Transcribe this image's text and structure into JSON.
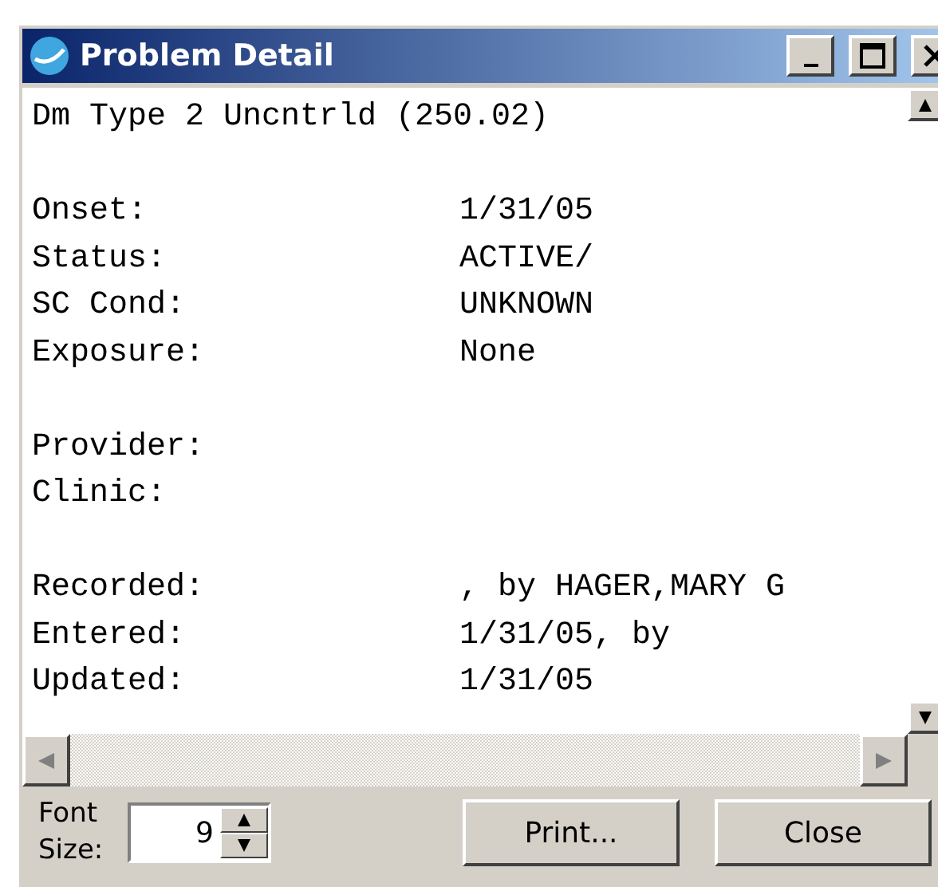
{
  "window": {
    "title": "Problem Detail"
  },
  "problem": "Dm Type 2 Uncntrld (250.02)",
  "sections": [
    [
      {
        "label": "Onset:",
        "value": "1/31/05"
      },
      {
        "label": "Status:",
        "value": "ACTIVE/"
      },
      {
        "label": "SC Cond:",
        "value": "UNKNOWN"
      },
      {
        "label": "Exposure:",
        "value": "None"
      }
    ],
    [
      {
        "label": "Provider:"
      },
      {
        "label": "Clinic:"
      }
    ],
    [
      {
        "label": "Recorded:",
        "value": ", by HAGER,MARY G"
      },
      {
        "label": "Entered:",
        "value": "1/31/05, by"
      },
      {
        "label": "Updated:",
        "value": "1/31/05"
      }
    ]
  ],
  "font_size": {
    "label": "Font Size:",
    "value": "9"
  },
  "buttons": [
    "Print...",
    "Close"
  ]
}
